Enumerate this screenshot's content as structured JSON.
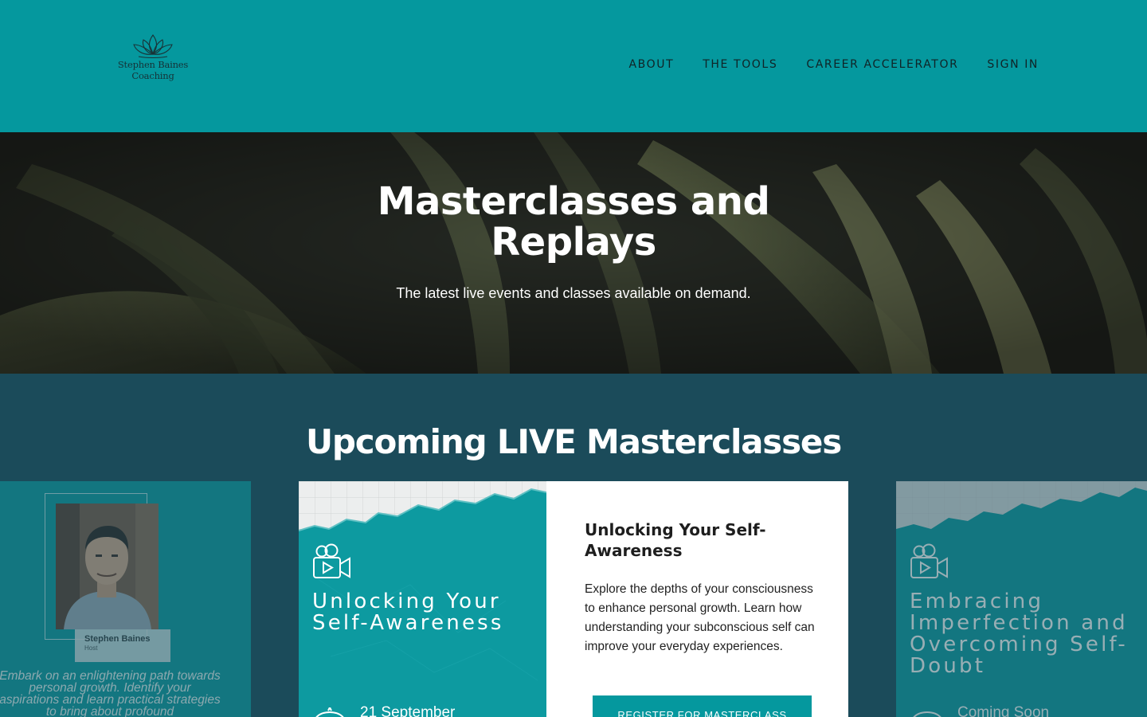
{
  "header": {
    "logo_line1": "Stephen Baines",
    "logo_line2": "Coaching",
    "nav": [
      "ABOUT",
      "THE TOOLS",
      "CAREER ACCELERATOR",
      "SIGN IN"
    ]
  },
  "hero": {
    "title_line1": "Masterclasses and",
    "title_line2": "Replays",
    "subtitle": "The latest live events and classes available on demand."
  },
  "section": {
    "title": "Upcoming LIVE Masterclasses"
  },
  "cards": {
    "left": {
      "host_name": "Stephen Baines",
      "host_role": "Host",
      "description": "Embark on an enlightening path towards personal growth. Identify your aspirations and learn practical strategies to bring about profound"
    },
    "center": {
      "poster_title": "Unlocking Your Self-Awareness",
      "date": "21 September",
      "title": "Unlocking Your Self-Awareness",
      "description": "Explore the depths of your consciousness to enhance personal growth. Learn how understanding your subconscious self can improve your everyday experiences.",
      "button_label": "REGISTER FOR MASTERCLASS"
    },
    "right": {
      "poster_title": "Embracing Imperfection and Overcoming Self-Doubt",
      "date": "Coming Soon"
    }
  },
  "colors": {
    "header_bg": "#05989e",
    "section_bg": "#1b4b5a",
    "poster_teal": "#0d9aa0",
    "button": "#05989e"
  }
}
